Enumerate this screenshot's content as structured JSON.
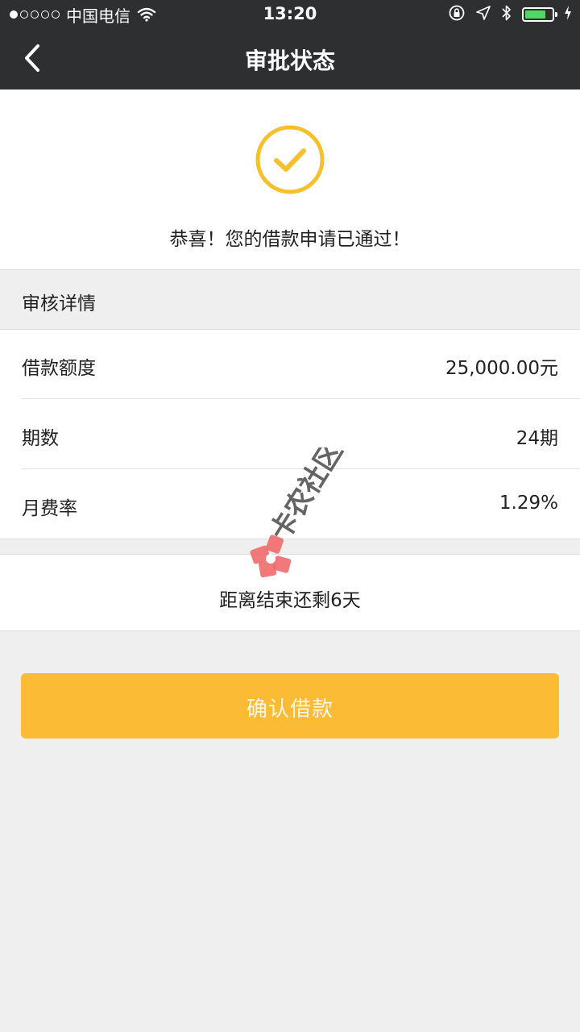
{
  "status_bar": {
    "carrier": "中国电信",
    "time": "13:20",
    "signal_strength": "1 of 5",
    "battery_level": 0.7,
    "battery_color": "#4cd964"
  },
  "nav": {
    "title": "审批状态",
    "back_icon": "chevron-left-icon"
  },
  "success": {
    "icon": "check-circle-icon",
    "icon_color": "#f6c02d",
    "message": "恭喜！您的借款申请已通过！"
  },
  "details": {
    "header": "审核详情",
    "rows": [
      {
        "label": "借款额度",
        "value": "25,000.00元"
      },
      {
        "label": "期数",
        "value": "24期"
      },
      {
        "label": "月费率",
        "value": "1.29%"
      }
    ]
  },
  "countdown": {
    "text": "距离结束还剩6天"
  },
  "actions": {
    "confirm_label": "确认借款",
    "confirm_color": "#fbbb34"
  },
  "watermark": {
    "text": "卡农社区"
  }
}
